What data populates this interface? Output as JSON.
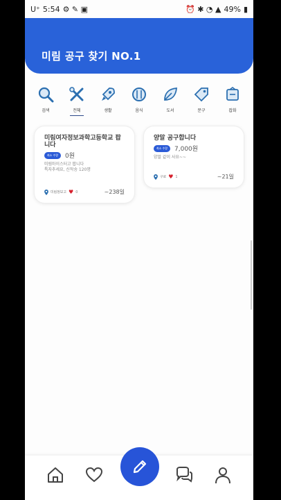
{
  "status": {
    "carrier": "U⁺",
    "time": "5:54",
    "battery": "49%"
  },
  "header": {
    "title": "미림 공구 찾기 NO.1"
  },
  "categories": [
    {
      "label": "검색",
      "icon": "search-icon"
    },
    {
      "label": "전체",
      "icon": "tools-icon"
    },
    {
      "label": "생활",
      "icon": "rocket-icon"
    },
    {
      "label": "음식",
      "icon": "food-icon"
    },
    {
      "label": "도서",
      "icon": "leaf-icon"
    },
    {
      "label": "문구",
      "icon": "tag-icon"
    },
    {
      "label": "잡화",
      "icon": "box-icon"
    }
  ],
  "cards": [
    {
      "title": "미림여자정보과학고등학교 팝니다",
      "badge": "최소 수량",
      "price": "0원",
      "desc1": "미림마이스터고 팝니다",
      "desc2": "특자추세요, 신작송 120명",
      "location": "미림정보고",
      "likes": "0",
      "days": "~238일"
    },
    {
      "title": "양말 공구합니다",
      "badge": "최소 수량",
      "price": "7,000원",
      "desc1": "양말 같이 사요~~",
      "location": "구로",
      "likes": "1",
      "days": "~21일"
    }
  ],
  "colors": {
    "primary": "#2962d9",
    "icon": "#2b6fb0",
    "heart": "#d61f2c"
  }
}
